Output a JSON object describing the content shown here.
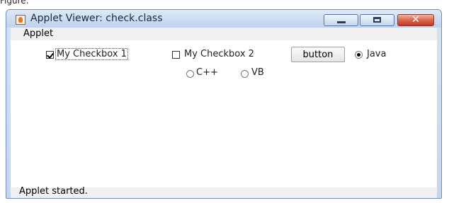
{
  "caption": "Figure:",
  "window": {
    "title": "Applet Viewer: check.class",
    "icon": "java-cup-icon",
    "controls": {
      "minimize": "minimize-icon",
      "maximize": "maximize-icon",
      "close": "close-icon",
      "close_glyph": "✕"
    }
  },
  "menu": {
    "items": [
      {
        "label": "Applet"
      }
    ]
  },
  "applet": {
    "checkboxes": [
      {
        "label": "My Checkbox 1",
        "checked": true,
        "focused": true
      },
      {
        "label": "My Checkbox 2",
        "checked": false
      }
    ],
    "button_label": "button",
    "radios": [
      {
        "label": "Java",
        "selected": true
      },
      {
        "label": "C++",
        "selected": false
      },
      {
        "label": "VB",
        "selected": false
      }
    ]
  },
  "status": {
    "text": "Applet started."
  },
  "colors": {
    "titlebar": "#c3d6ee",
    "close_button": "#c0392b",
    "client_bg": "#ffffff"
  }
}
